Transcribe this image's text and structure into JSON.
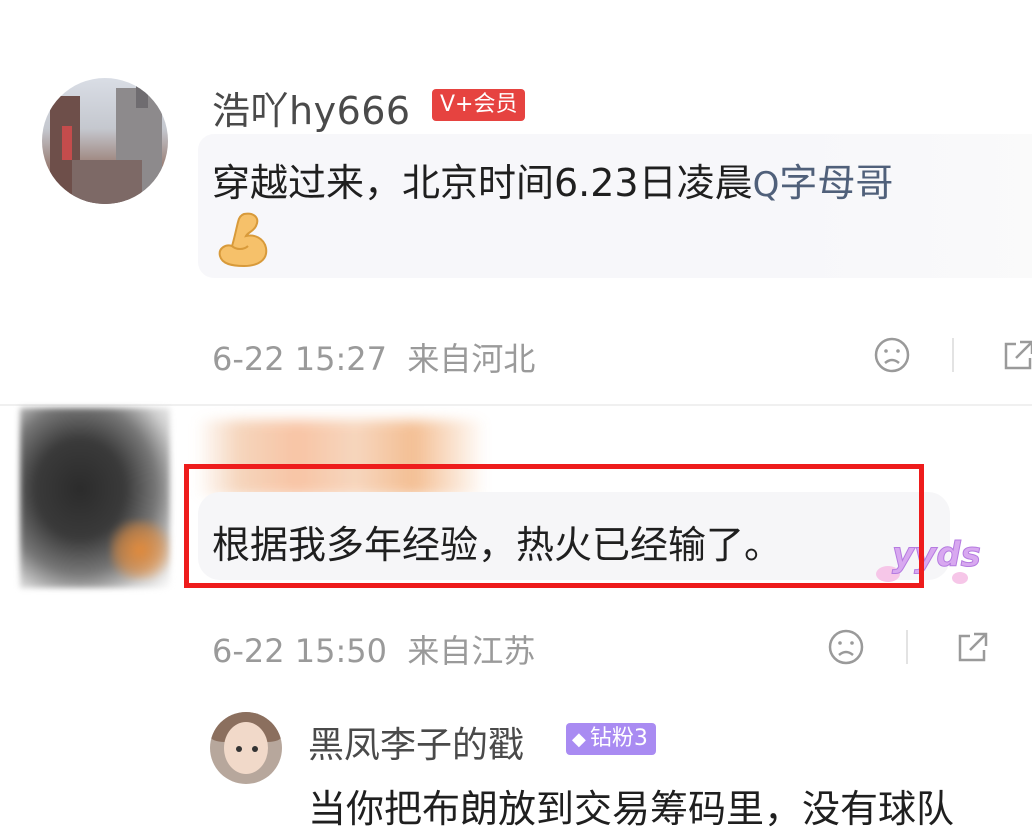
{
  "comments": [
    {
      "username": "浩吖hy666",
      "badge": "V+会员",
      "text": "穿越过来，北京时间6.23日凌晨",
      "topic": "字母哥",
      "time": "6-22 15:27",
      "location": "来自河北",
      "emoji": "flexed-biceps"
    },
    {
      "username": "",
      "text": "根据我多年经验，热火已经输了。",
      "sticker_text": "yyds",
      "time": "6-22 15:50",
      "location": "来自江苏",
      "highlighted": true
    }
  ],
  "reply": {
    "username": "黑凤李子的戳",
    "badge": "钻粉3",
    "text": "当你把布朗放到交易筹码里，没有球队"
  },
  "colors": {
    "vip_badge": "#e64340",
    "fan_badge": "#a98bf2",
    "highlight": "#ee1c1c",
    "topic": "#50607a"
  }
}
